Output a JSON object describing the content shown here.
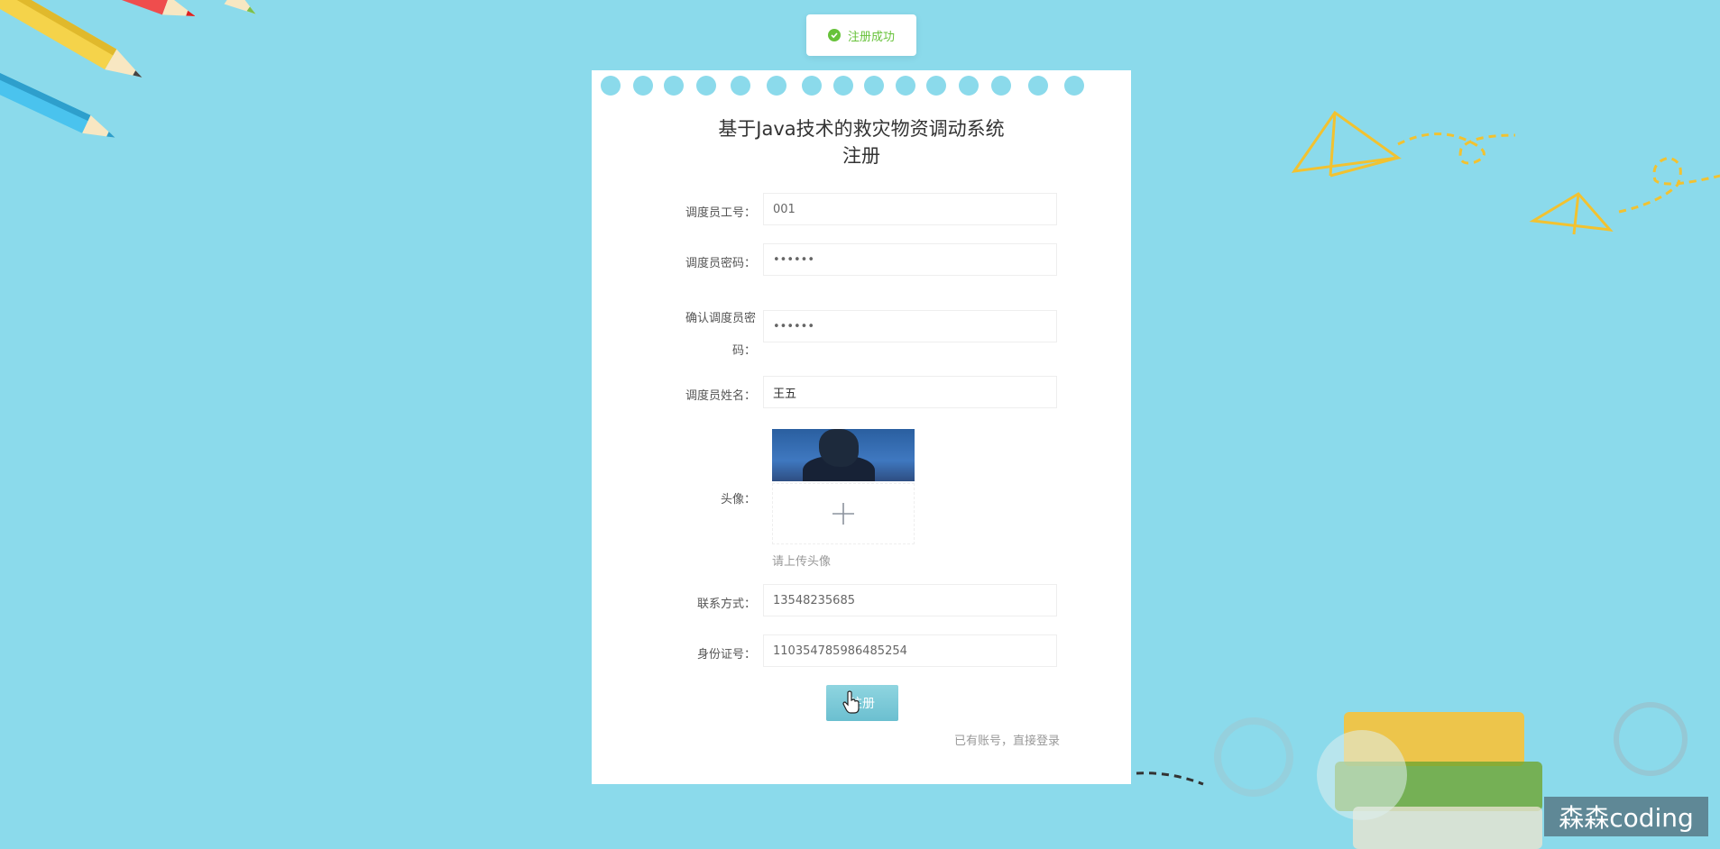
{
  "toast": {
    "message": "注册成功",
    "color": "#67c23a"
  },
  "form": {
    "title_line1": "基于Java技术的救灾物资调动系统",
    "title_line2": "注册",
    "fields": [
      {
        "label": "调度员工号：",
        "value": "001"
      },
      {
        "label": "调度员密码：",
        "value": "••••••"
      },
      {
        "label_line1": "确认调度员密",
        "label_line2": "码：",
        "value": "••••••"
      },
      {
        "label": "调度员姓名：",
        "value": "王五"
      },
      {
        "label": "头像：",
        "hint": "请上传头像"
      },
      {
        "label": "联系方式：",
        "value": "13548235685"
      },
      {
        "label": "身份证号：",
        "value": "110354785986485254"
      }
    ],
    "submit_label": "注册",
    "login_link": "已有账号，直接登录"
  },
  "watermark": "森森coding",
  "colors": {
    "background": "#8bdaeb",
    "accent": "#6bbfd0",
    "deco_yellow": "#f2c230"
  },
  "icons": [
    "check-circle-icon",
    "plus-icon",
    "hand-cursor-icon"
  ]
}
